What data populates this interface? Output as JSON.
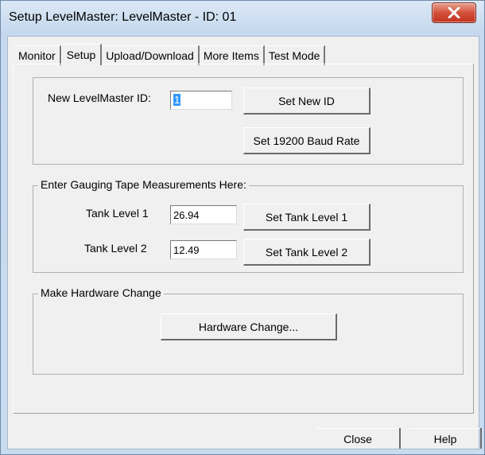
{
  "window": {
    "title": "Setup LevelMaster: LevelMaster - ID: 01",
    "close_glyph": "X"
  },
  "tabs": [
    {
      "label": "Monitor"
    },
    {
      "label": "Setup"
    },
    {
      "label": "Upload/Download"
    },
    {
      "label": "More Items"
    },
    {
      "label": "Test Mode"
    }
  ],
  "active_tab": "Setup",
  "id_section": {
    "label": "New LevelMaster ID:",
    "value": "1",
    "set_id_button": "Set New ID",
    "baud_button": "Set 19200 Baud Rate"
  },
  "gauging": {
    "legend": "Enter Gauging Tape Measurements Here:",
    "tank1_label": "Tank Level 1",
    "tank1_value": "26.94",
    "tank1_button": "Set Tank Level 1",
    "tank2_label": "Tank Level 2",
    "tank2_value": "12.49",
    "tank2_button": "Set Tank Level 2"
  },
  "hardware": {
    "legend": "Make Hardware Change",
    "button": "Hardware Change..."
  },
  "footer": {
    "close_label": "Close",
    "help_label": "Help"
  }
}
